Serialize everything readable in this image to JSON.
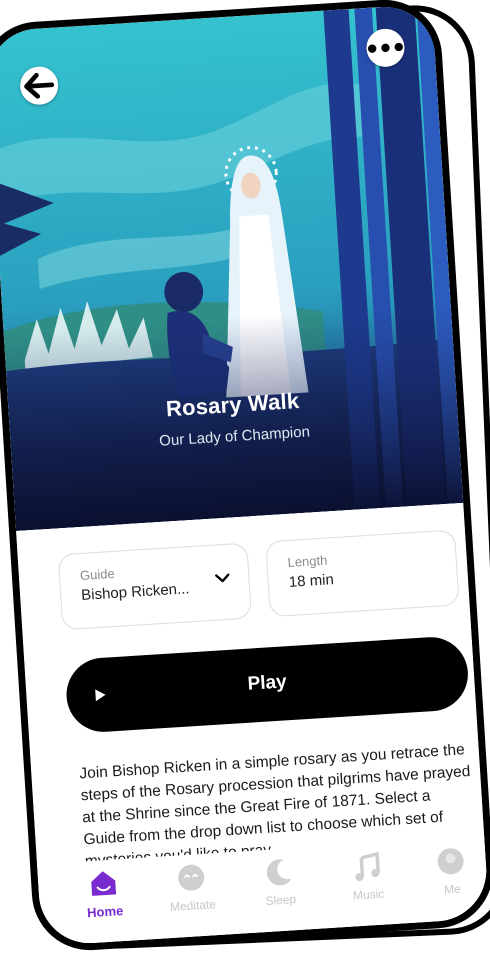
{
  "hero": {
    "title": "Rosary Walk",
    "subtitle": "Our Lady of Champion"
  },
  "guide": {
    "label": "Guide",
    "value": "Bishop Ricken..."
  },
  "length": {
    "label": "Length",
    "value": "18 min"
  },
  "play": {
    "label": "Play"
  },
  "description": "Join Bishop Ricken in a simple rosary as you retrace the steps of the Rosary procession that pilgrims have prayed at the Shrine since the Great Fire of 1871.  Select a Guide from the drop down list to choose which set of mysteries you'd like to pray.",
  "nav": [
    {
      "label": "Home",
      "icon": "home-icon",
      "active": true
    },
    {
      "label": "Meditate",
      "icon": "meditate-icon",
      "active": false
    },
    {
      "label": "Sleep",
      "icon": "moon-icon",
      "active": false
    },
    {
      "label": "Music",
      "icon": "music-note-icon",
      "active": false
    },
    {
      "label": "Me",
      "icon": "profile-icon",
      "active": false
    }
  ],
  "colors": {
    "accent": "#7a2bd0",
    "hero_sky": "#2fb3c6",
    "hero_dark": "#1c2f6e"
  }
}
